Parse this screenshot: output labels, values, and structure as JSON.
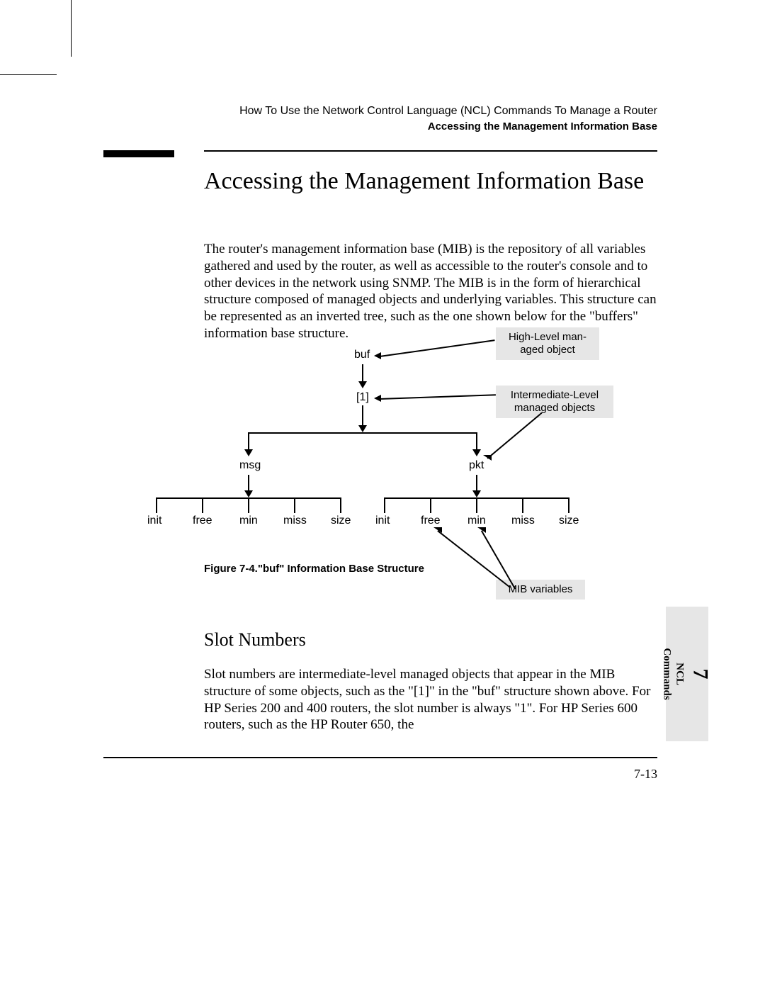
{
  "header": {
    "line1": "How To Use the Network Control Language (NCL) Commands To Manage a Router",
    "line2": "Accessing the Management Information Base"
  },
  "heading": "Accessing the Management Information Base",
  "para1": "The router's management information base (MIB) is the repository of all variables gathered and used by the router, as well as accessible to the router's console and to other devices in the network using SNMP. The MIB is in the form of hierarchical structure composed of managed objects and underlying variables. This structure can be represented as an inverted tree, such as the one shown below for the \"buffers\" information base structure.",
  "diagram": {
    "root": "buf",
    "slot": "[1]",
    "mid": {
      "left": "msg",
      "right": "pkt"
    },
    "leaves_left": [
      "init",
      "free",
      "min",
      "miss",
      "size"
    ],
    "leaves_right": [
      "init",
      "free",
      "min",
      "miss",
      "size"
    ],
    "annot_top": "High-Level man-\naged object",
    "annot_mid": "Intermediate-Level\nmanaged objects",
    "annot_bot": "MIB variables"
  },
  "fig_caption": "Figure  7-4.\"buf\" Information Base Structure",
  "subheading": "Slot Numbers",
  "para2": "Slot numbers are intermediate-level managed objects that appear in the MIB structure of some objects, such as the \"[1]\" in the \"buf\" structure shown above. For HP Series 200 and 400 routers, the slot number is always \"1\". For HP Series 600 routers, such as the HP Router 650, the",
  "page_num": "7-13",
  "side_tab": {
    "chapter": "7",
    "line1": "NCL",
    "line2": "Commands"
  }
}
